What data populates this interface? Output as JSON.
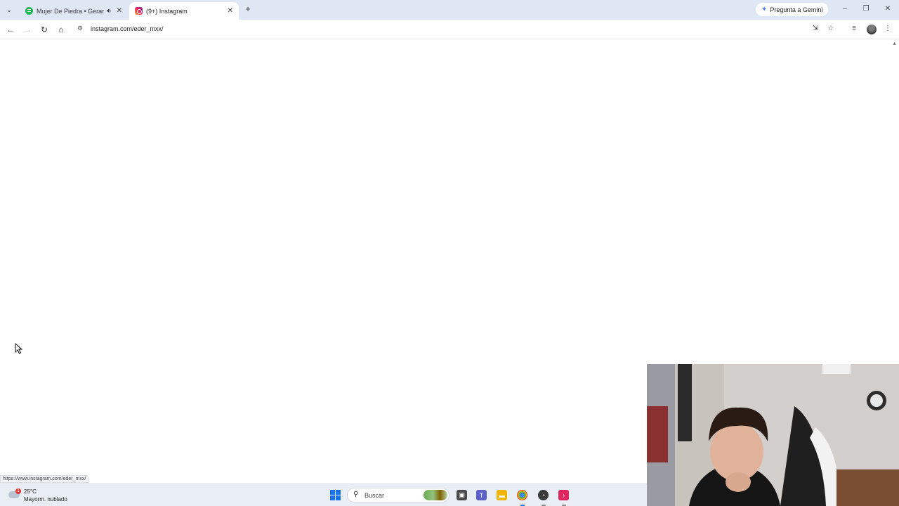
{
  "browser": {
    "tabs": [
      {
        "title": "Mujer De Piedra • Gerardo",
        "active": false,
        "audio": true
      },
      {
        "title": "(9+) Instagram",
        "active": true,
        "audio": false
      }
    ],
    "gemini_label": "Pregunta a Gemini",
    "url": "instagram.com/eder_mxx/",
    "status_url": "https://www.instagram.com/eder_mxx/"
  },
  "taskbar": {
    "weather": {
      "temp": "25°C",
      "condition": "Mayorm. nublado",
      "badge": "1"
    },
    "search_placeholder": "Buscar"
  },
  "colors": {
    "tabstrip_bg": "#dfe7f5",
    "spotify": "#1db954",
    "taskbar_bg": "#e9eef4",
    "windows_blue": "#1a73e8"
  }
}
